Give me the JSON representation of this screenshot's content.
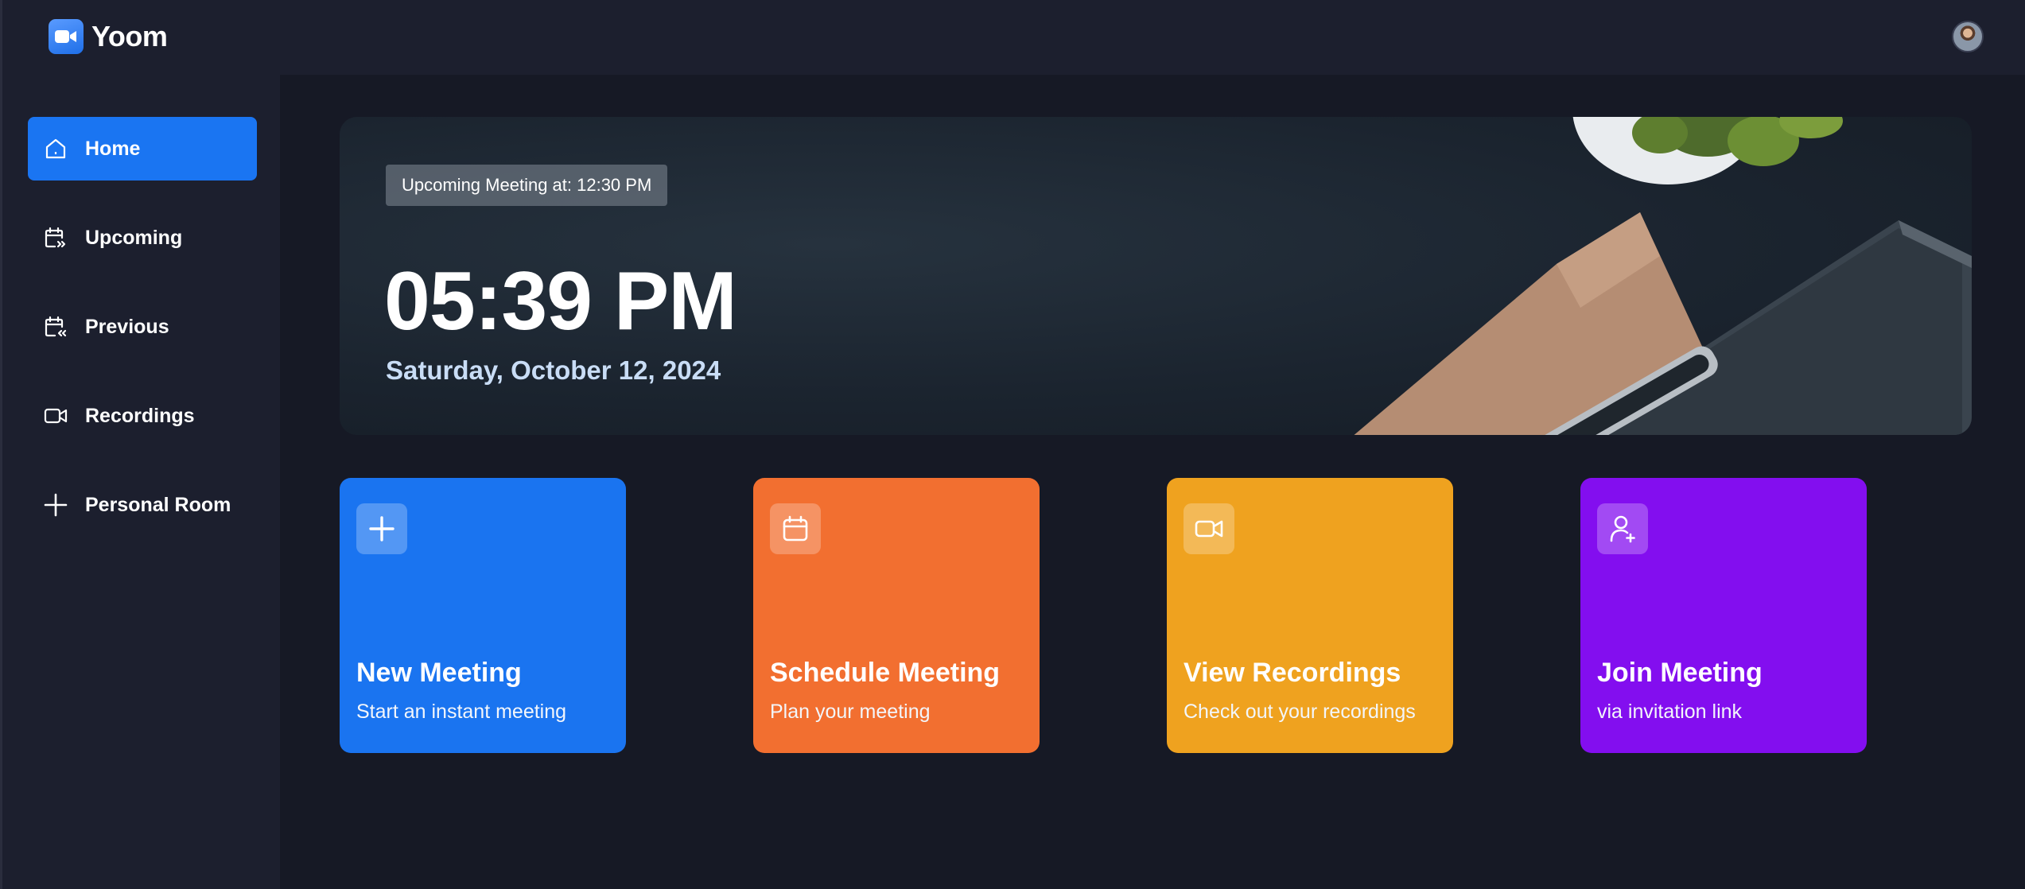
{
  "app": {
    "name": "Yoom"
  },
  "sidebar": {
    "items": [
      {
        "label": "Home",
        "icon": "home-icon",
        "active": true
      },
      {
        "label": "Upcoming",
        "icon": "calendar-upcoming-icon"
      },
      {
        "label": "Previous",
        "icon": "calendar-previous-icon"
      },
      {
        "label": "Recordings",
        "icon": "video-icon"
      },
      {
        "label": "Personal Room",
        "icon": "plus-icon"
      }
    ]
  },
  "hero": {
    "badge": "Upcoming Meeting at: 12:30 PM",
    "time": "05:39 PM",
    "date": "Saturday, October 12, 2024"
  },
  "cards": [
    {
      "title": "New Meeting",
      "subtitle": "Start an instant meeting",
      "icon": "plus-icon",
      "color": "#1a74f0"
    },
    {
      "title": "Schedule Meeting",
      "subtitle": "Plan your meeting",
      "icon": "calendar-icon",
      "color": "#f26f30"
    },
    {
      "title": "View Recordings",
      "subtitle": "Check out your recordings",
      "icon": "video-icon",
      "color": "#efa21f"
    },
    {
      "title": "Join Meeting",
      "subtitle": "via invitation link",
      "icon": "user-plus-icon",
      "color": "#830eef"
    }
  ],
  "colors": {
    "background": "#161925",
    "panel": "#1c1f2e",
    "accent": "#1a75f2"
  }
}
